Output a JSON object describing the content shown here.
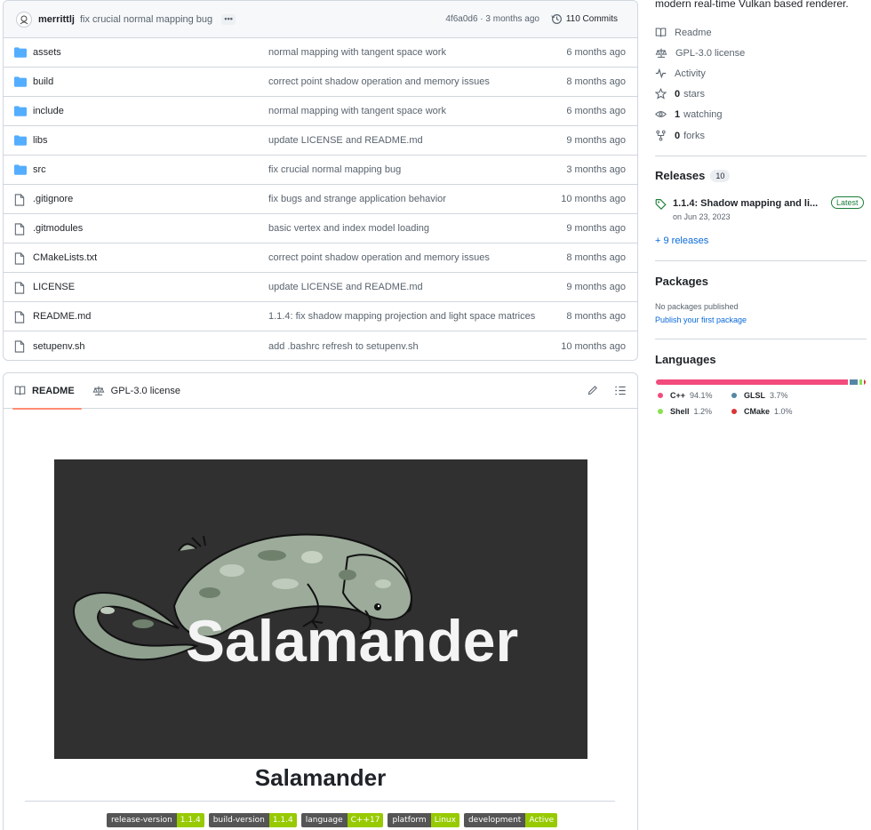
{
  "commit": {
    "author": "merrittlj",
    "message": "fix crucial normal mapping bug",
    "hash_time": "4f6a0d6 · 3 months ago",
    "commits": "110 Commits"
  },
  "files": [
    {
      "type": "folder",
      "name": "assets",
      "message": "normal mapping with tangent space work",
      "date": "6 months ago"
    },
    {
      "type": "folder",
      "name": "build",
      "message": "correct point shadow operation and memory issues",
      "date": "8 months ago"
    },
    {
      "type": "folder",
      "name": "include",
      "message": "normal mapping with tangent space work",
      "date": "6 months ago"
    },
    {
      "type": "folder",
      "name": "libs",
      "message": "update LICENSE and README.md",
      "date": "9 months ago"
    },
    {
      "type": "folder",
      "name": "src",
      "message": "fix crucial normal mapping bug",
      "date": "3 months ago"
    },
    {
      "type": "file",
      "name": ".gitignore",
      "message": "fix bugs and strange application behavior",
      "date": "10 months ago"
    },
    {
      "type": "file",
      "name": ".gitmodules",
      "message": "basic vertex and index model loading",
      "date": "9 months ago"
    },
    {
      "type": "file",
      "name": "CMakeLists.txt",
      "message": "correct point shadow operation and memory issues",
      "date": "8 months ago"
    },
    {
      "type": "file",
      "name": "LICENSE",
      "message": "update LICENSE and README.md",
      "date": "9 months ago"
    },
    {
      "type": "file",
      "name": "README.md",
      "message": "1.1.4: fix shadow mapping projection and light space matrices",
      "date": "8 months ago"
    },
    {
      "type": "file",
      "name": "setupenv.sh",
      "message": "add .bashrc refresh to setupenv.sh",
      "date": "10 months ago"
    }
  ],
  "readme": {
    "tab_readme": "README",
    "tab_license": "GPL-3.0 license",
    "banner_text": "Salamander",
    "title": "Salamander",
    "badges": [
      {
        "label": "release-version",
        "value": "1.1.4"
      },
      {
        "label": "build-version",
        "value": "1.1.4"
      },
      {
        "label": "language",
        "value": "C++17"
      },
      {
        "label": "platform",
        "value": "Linux"
      },
      {
        "label": "development",
        "value": "Active"
      }
    ]
  },
  "about": {
    "description": "modern real-time Vulkan based renderer.",
    "readme": "Readme",
    "license": "GPL-3.0 license",
    "activity": "Activity",
    "stars_count": "0",
    "stars_label": "stars",
    "watching_count": "1",
    "watching_label": "watching",
    "forks_count": "0",
    "forks_label": "forks"
  },
  "releases": {
    "title": "Releases",
    "count": "10",
    "latest_name": "1.1.4: Shadow mapping and li...",
    "latest_badge": "Latest",
    "latest_date": "on Jun 23, 2023",
    "more": "+ 9 releases"
  },
  "packages": {
    "title": "Packages",
    "none": "No packages published",
    "publish": "Publish your first package"
  },
  "languages": {
    "title": "Languages",
    "items": [
      {
        "name": "C++",
        "percent": "94.1%",
        "value": 94.1,
        "color": "#f34b7d"
      },
      {
        "name": "GLSL",
        "percent": "3.7%",
        "value": 3.7,
        "color": "#5686a5"
      },
      {
        "name": "Shell",
        "percent": "1.2%",
        "value": 1.2,
        "color": "#89e051"
      },
      {
        "name": "CMake",
        "percent": "1.0%",
        "value": 1.0,
        "color": "#da3434"
      }
    ]
  }
}
